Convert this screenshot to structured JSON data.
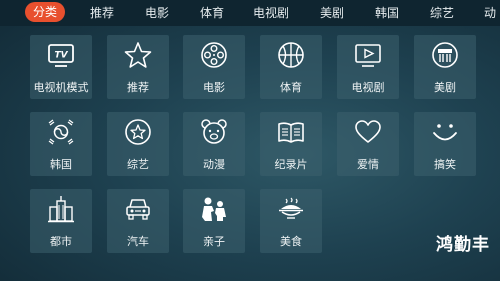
{
  "tabs": [
    {
      "label": "分类",
      "active": true
    },
    {
      "label": "推荐"
    },
    {
      "label": "电影"
    },
    {
      "label": "体育"
    },
    {
      "label": "电视剧"
    },
    {
      "label": "美剧"
    },
    {
      "label": "韩国"
    },
    {
      "label": "综艺"
    },
    {
      "label": "动"
    }
  ],
  "tiles": [
    {
      "label": "电视机模式",
      "icon": "tv-icon",
      "tv_text": "TV"
    },
    {
      "label": "推荐",
      "icon": "star-icon"
    },
    {
      "label": "电影",
      "icon": "film-reel-icon"
    },
    {
      "label": "体育",
      "icon": "basketball-icon"
    },
    {
      "label": "电视剧",
      "icon": "tv-play-icon"
    },
    {
      "label": "美剧",
      "icon": "us-badge-icon"
    },
    {
      "label": "韩国",
      "icon": "korea-flag-icon"
    },
    {
      "label": "综艺",
      "icon": "variety-star-icon"
    },
    {
      "label": "动漫",
      "icon": "bear-icon"
    },
    {
      "label": "纪录片",
      "icon": "book-icon"
    },
    {
      "label": "爱情",
      "icon": "heart-icon"
    },
    {
      "label": "搞笑",
      "icon": "smile-icon"
    },
    {
      "label": "都市",
      "icon": "city-building-icon"
    },
    {
      "label": "汽车",
      "icon": "car-icon"
    },
    {
      "label": "亲子",
      "icon": "parent-child-icon"
    },
    {
      "label": "美食",
      "icon": "food-dish-icon"
    }
  ],
  "brand": "鸿勤丰",
  "colors": {
    "accent": "#e8502e",
    "tile": "#3c606e",
    "background": "#1e4150"
  }
}
